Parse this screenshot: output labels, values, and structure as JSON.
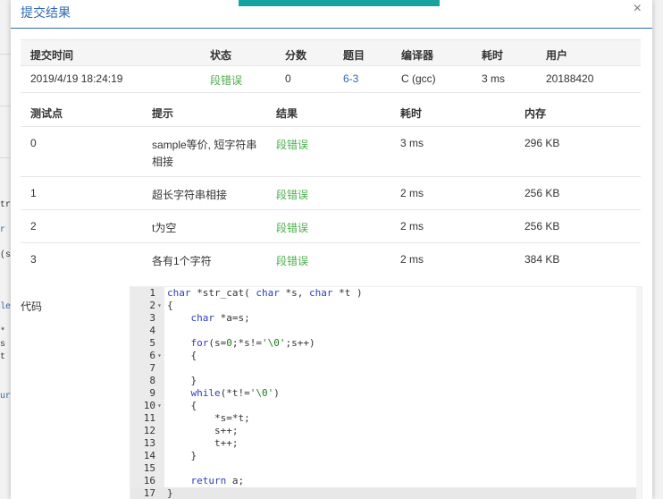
{
  "modal": {
    "title": "提交结果",
    "close": "×"
  },
  "background": {
    "frags": [
      "tr",
      "r",
      "(s",
      "le",
      "*",
      "s",
      "t",
      "ur"
    ]
  },
  "submission": {
    "headers": [
      "提交时间",
      "状态",
      "分数",
      "题目",
      "编译器",
      "耗时",
      "用户"
    ],
    "row": {
      "time": "2019/4/19 18:24:19",
      "status": "段错误",
      "score": "0",
      "problem": "6-3",
      "compiler": "C (gcc)",
      "elapsed": "3 ms",
      "user": "20188420"
    }
  },
  "cases": {
    "headers": [
      "测试点",
      "提示",
      "结果",
      "耗时",
      "内存"
    ],
    "rows": [
      {
        "id": "0",
        "hint": "sample等价, 短字符串",
        "hint2": "相接",
        "result": "段错误",
        "time": "3 ms",
        "mem": "296 KB"
      },
      {
        "id": "1",
        "hint": "超长字符串相接",
        "hint2": "",
        "result": "段错误",
        "time": "2 ms",
        "mem": "256 KB"
      },
      {
        "id": "2",
        "hint": "t为空",
        "hint2": "",
        "result": "段错误",
        "time": "2 ms",
        "mem": "256 KB"
      },
      {
        "id": "3",
        "hint": "各有1个字符",
        "hint2": "",
        "result": "段错误",
        "time": "2 ms",
        "mem": "384 KB"
      }
    ]
  },
  "code": {
    "label": "代码",
    "lines": [
      "char *str_cat( char *s, char *t )",
      "{",
      "    char *a=s;",
      "",
      "    for(s=0;*s!='\\0';s++)",
      "    {",
      "",
      "    }",
      "    while(*t!='\\0')",
      "    {",
      "        *s=*t;",
      "        s++;",
      "        t++;",
      "    }",
      "",
      "    return a;",
      "}"
    ],
    "fold_lines": [
      2,
      6,
      10
    ],
    "active_line": 17
  },
  "colors": {
    "accent": "#2e6ab0",
    "teal": "#17a2a0",
    "error_green": "#4cae4c"
  }
}
